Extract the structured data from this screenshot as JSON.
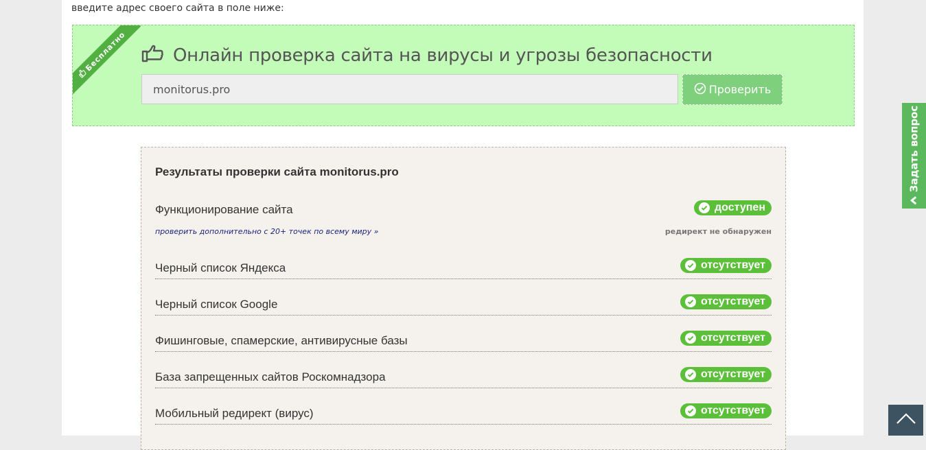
{
  "intro_text": "введите адрес своего сайта в поле ниже:",
  "check": {
    "ribbon": "Бесплатно",
    "title": "Онлайн проверка сайта на вирусы и угрозы безопасности",
    "input_value": "monitorus.pro",
    "button_label": "Проверить"
  },
  "results": {
    "title": "Результаты проверки сайта monitorus.pro",
    "availability": {
      "label": "Функционирование сайта",
      "status": "доступен",
      "extra_link": "проверить дополнительно с 20+ точек по всему миру »",
      "redirect_note": "редирект не обнаружен"
    },
    "rows": [
      {
        "label": "Черный список Яндекса",
        "status": "отсутствует"
      },
      {
        "label": "Черный список Google",
        "status": "отсутствует"
      },
      {
        "label": "Фишинговые, спамерские, антивирусные базы",
        "status": "отсутствует"
      },
      {
        "label": "База запрещенных сайтов Роскомнадзора",
        "status": "отсутствует"
      },
      {
        "label": "Мобильный редирект (вирус)",
        "status": "отсутствует"
      }
    ]
  },
  "ask_tab": {
    "label": "Задать вопрос"
  },
  "colors": {
    "accent_green": "#5cbf3a",
    "check_bg": "#c2fcb8",
    "results_bg": "#f5f2ed",
    "scroll_top_bg": "#3e5362"
  }
}
